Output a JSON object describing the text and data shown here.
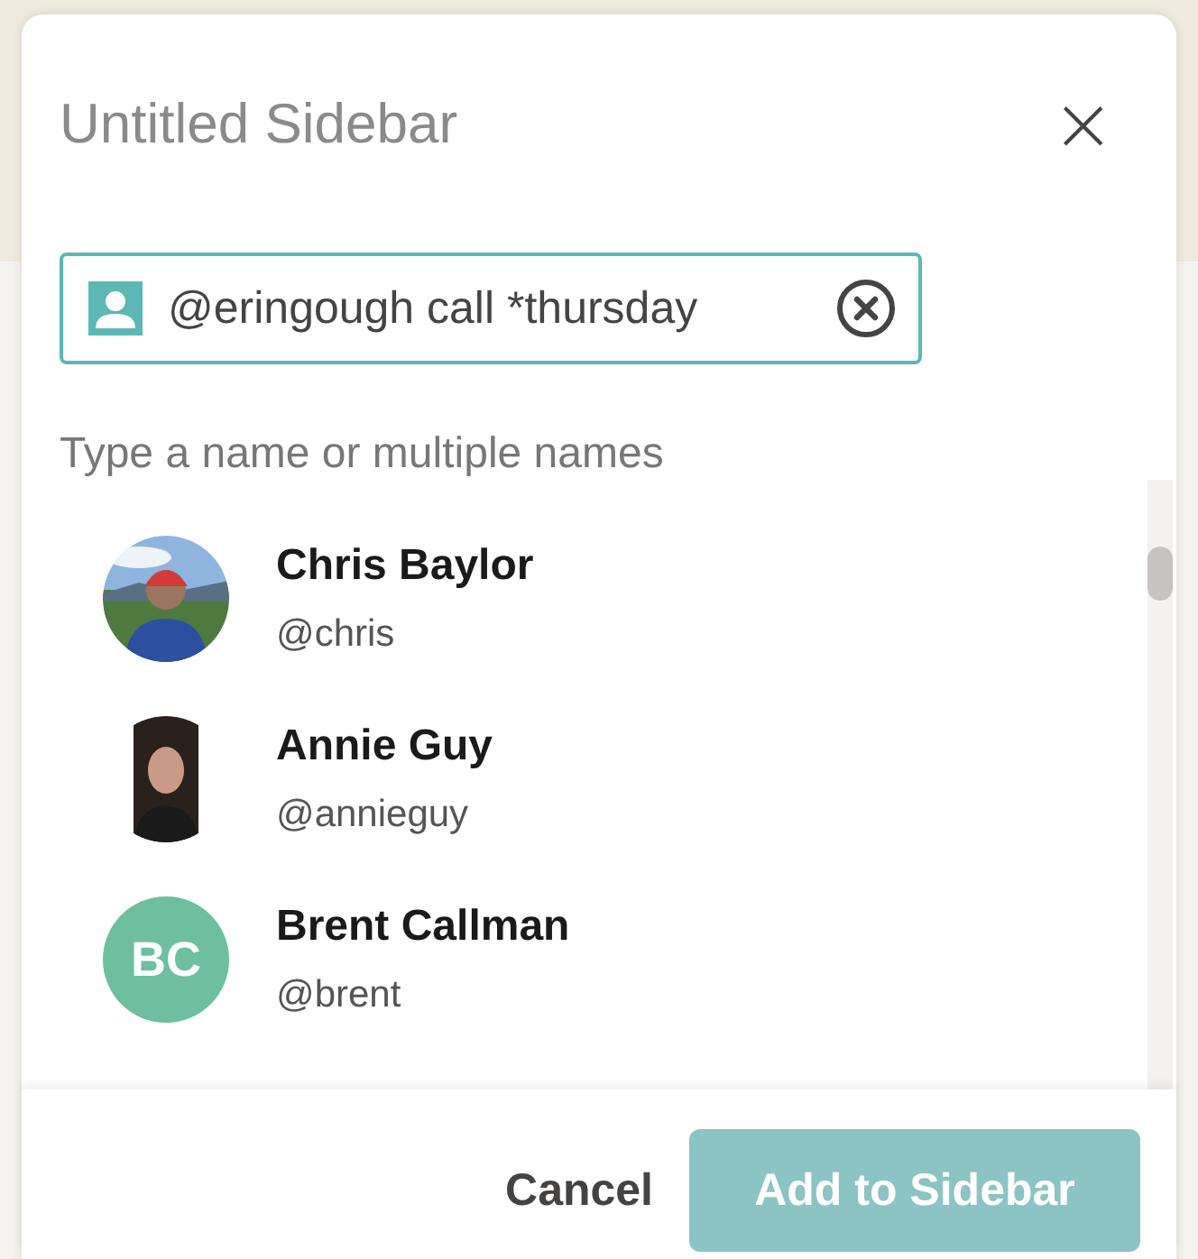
{
  "dialog": {
    "title": "Untitled Sidebar",
    "close": "×"
  },
  "search": {
    "value": "@eringough call *thursday"
  },
  "hint": "Type a name or multiple names",
  "people": [
    {
      "name": "Chris Baylor",
      "handle": "@chris"
    },
    {
      "name": "Annie Guy",
      "handle": "@annieguy"
    },
    {
      "kind": "initials",
      "name": "Brent Callman",
      "handle": "@brent",
      "initials": "BC",
      "color": "#6dbf9f"
    }
  ],
  "buttons": [
    {
      "kind": "text",
      "label": "Cancel",
      "disabled": false
    },
    {
      "kind": "primary",
      "label": "Add to Sidebar",
      "disabled": true
    }
  ]
}
